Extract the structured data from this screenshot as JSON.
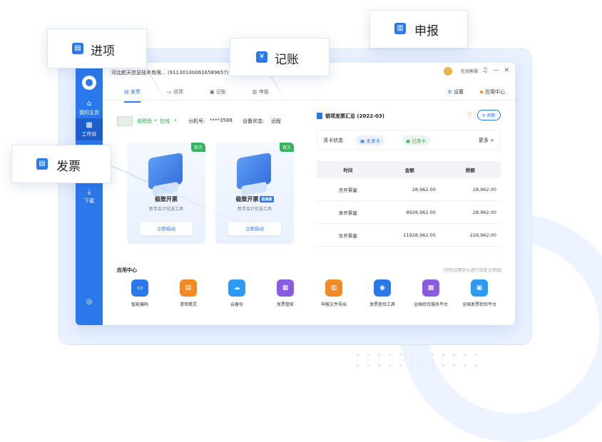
{
  "callouts": {
    "jinxiang": "进项",
    "jizhang": "记账",
    "shenbao": "申报",
    "fapiao": "发票"
  },
  "titlebar": {
    "company": "河北航天信息技术有限... (911301000616589657)",
    "service": "在线客服",
    "minimize": "—",
    "close": "✕"
  },
  "sidebar": {
    "items": [
      {
        "label": "我的主页",
        "icon": "home-icon"
      },
      {
        "label": "工作台",
        "icon": "grid-icon"
      },
      {
        "label": "下载",
        "icon": "download-icon"
      }
    ]
  },
  "tabs": [
    {
      "label": "发票",
      "active": true
    },
    {
      "label": "进项"
    },
    {
      "label": "记账"
    },
    {
      "label": "申报"
    }
  ],
  "tab_right": {
    "settings": "设置",
    "app_center": "应用中心"
  },
  "status": {
    "device": "金税盘",
    "online": "在线",
    "branch_label": "分机号:",
    "branch_value": "****3588",
    "device_state_label": "设备状态:",
    "device_state_value": "远程"
  },
  "cards": [
    {
      "badge": "官方",
      "name": "极致开票",
      "desc": "新手会计优选工具",
      "button": "立即启动",
      "new": ""
    },
    {
      "badge": "官方",
      "name": "极致开票",
      "desc": "新手会计优选工具",
      "button": "立即启动",
      "new": "极速版"
    }
  ],
  "summary": {
    "title": "销项发票汇总 (2022-03)",
    "refresh": "刷新",
    "clear_label": "清卡状态",
    "not_cleared": "未清卡",
    "cleared": "已清卡",
    "more": "更多 >",
    "headers": [
      "时间",
      "金额",
      "税额"
    ],
    "rows": [
      [
        "月开票量",
        "28,962.00",
        "28,962.00"
      ],
      [
        "季开票量",
        "8928,962.00",
        "28,962.00"
      ],
      [
        "年开票量",
        "11928,962.00",
        "228,962.00"
      ]
    ]
  },
  "apps": {
    "title": "应用中心",
    "hint": "(可在应用中心进行自定义添加)",
    "items": [
      {
        "label": "智能编码",
        "icon": "code-icon",
        "color": "#2b78ea"
      },
      {
        "label": "清单精灵",
        "icon": "list-icon",
        "color": "#f08a24"
      },
      {
        "label": "云备份",
        "icon": "cloud-icon",
        "color": "#2b9af0"
      },
      {
        "label": "发票管家",
        "icon": "invoice-manager-icon",
        "color": "#8a5ae0"
      },
      {
        "label": "申报文件导出",
        "icon": "export-icon",
        "color": "#f08a24"
      },
      {
        "label": "发票查验工具",
        "icon": "verify-icon",
        "color": "#2b78ea"
      },
      {
        "label": "全国综合服务平台",
        "icon": "platform-icon",
        "color": "#8a5ae0"
      },
      {
        "label": "全国发票检验平台",
        "icon": "check-platform-icon",
        "color": "#2b9af0"
      }
    ]
  }
}
